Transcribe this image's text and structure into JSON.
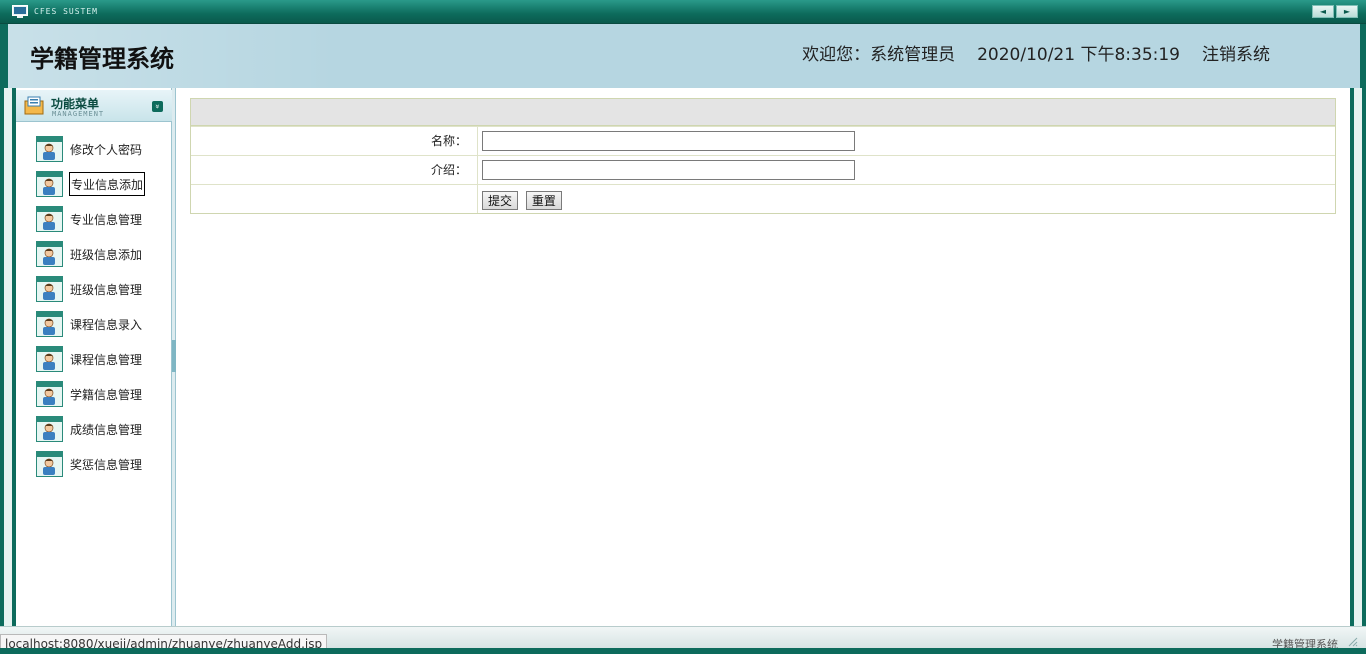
{
  "window": {
    "system_label": "CFES SUSTEM",
    "prev_glyph": "◄",
    "next_glyph": "►",
    "icons": {
      "system": "monitor-icon"
    }
  },
  "header": {
    "app_title": "学籍管理系统",
    "welcome_prefix": "欢迎您：",
    "user_name": "系统管理员",
    "datetime": "2020/10/21 下午8:35:19",
    "logout_label": "注销系统"
  },
  "sidebar": {
    "head_title": "功能菜单",
    "head_subtitle": "MANAGEMENT",
    "collapse_glyph": "»",
    "items": [
      {
        "label": "修改个人密码",
        "icon": "user-card-icon"
      },
      {
        "label": "专业信息添加",
        "icon": "user-card-icon"
      },
      {
        "label": "专业信息管理",
        "icon": "user-card-icon"
      },
      {
        "label": "班级信息添加",
        "icon": "user-card-icon"
      },
      {
        "label": "班级信息管理",
        "icon": "user-card-icon"
      },
      {
        "label": "课程信息录入",
        "icon": "user-card-icon"
      },
      {
        "label": "课程信息管理",
        "icon": "user-card-icon"
      },
      {
        "label": "学籍信息管理",
        "icon": "user-card-icon"
      },
      {
        "label": "成绩信息管理",
        "icon": "user-card-icon"
      },
      {
        "label": "奖惩信息管理",
        "icon": "user-card-icon"
      }
    ]
  },
  "form": {
    "name_label": "名称：",
    "name_value": "",
    "intro_label": "介绍：",
    "intro_value": "",
    "submit_label": "提交",
    "reset_label": "重置"
  },
  "status": {
    "url": "localhost:8080/xueji/admin/zhuanye/zhuanyeAdd.jsp",
    "footer_title": "学籍管理系统"
  },
  "colors": {
    "frame": "#0d6b5c",
    "header_bg": "#b6d6e1",
    "table_head": "#e4e4e4"
  }
}
